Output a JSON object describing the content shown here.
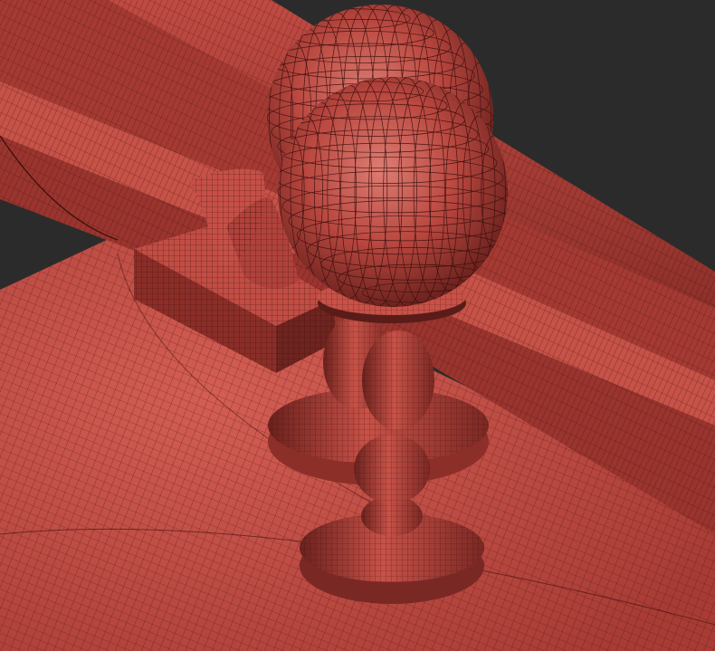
{
  "viewport": {
    "background": "#2b2b2b",
    "render_mode": "wireframe-over-shaded"
  },
  "palette": {
    "surface": "#b8473f",
    "surface_light": "#cf5a50",
    "surface_dark": "#7e2a25",
    "surface_shadow": "#5a1c18",
    "wire": "#3a0f0d",
    "highlight": "#e08a80"
  },
  "scene": {
    "objects": [
      {
        "name": "table-top",
        "kind": "plane"
      },
      {
        "name": "back-rail",
        "kind": "box"
      },
      {
        "name": "inner-rail",
        "kind": "box"
      },
      {
        "name": "small-box",
        "kind": "box"
      },
      {
        "name": "folded-napkin",
        "kind": "cloth"
      },
      {
        "name": "candle-holder-back",
        "kind": "lathe"
      },
      {
        "name": "candle-holder-front",
        "kind": "lathe"
      },
      {
        "name": "globe-back",
        "kind": "sphere"
      },
      {
        "name": "globe-front",
        "kind": "sphere"
      }
    ]
  }
}
